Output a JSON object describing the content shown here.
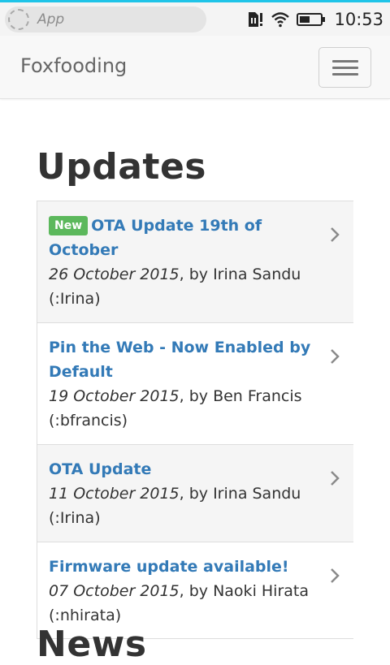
{
  "status_bar": {
    "app_label": "App",
    "time": "10:53",
    "icons": [
      "sim-alert-icon",
      "wifi-icon",
      "battery-icon"
    ],
    "accent_color": "#1fc4e8"
  },
  "navbar": {
    "brand": "Foxfooding",
    "menu_icon": "hamburger-icon"
  },
  "updates": {
    "heading": "Updates",
    "items": [
      {
        "badge": "New",
        "title": "OTA Update 19th of October",
        "date": "26 October 2015",
        "by": ", by Irina Sandu",
        "handle": "(:Irina)"
      },
      {
        "badge": "",
        "title": "Pin the Web - Now Enabled by Default",
        "date": "19 October 2015",
        "by": ", by Ben Francis",
        "handle": "(:bfrancis)"
      },
      {
        "badge": "",
        "title": "OTA Update",
        "date": "11 October 2015",
        "by": ", by Irina Sandu",
        "handle": "(:Irina)"
      },
      {
        "badge": "",
        "title": "Firmware update available!",
        "date": "07 October 2015",
        "by": ", by Naoki Hirata",
        "handle": "(:nhirata)"
      }
    ]
  },
  "news": {
    "heading": "News"
  },
  "colors": {
    "link": "#337ab7",
    "badge": "#5cb85c"
  }
}
